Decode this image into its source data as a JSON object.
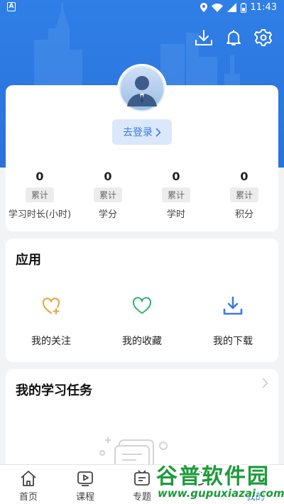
{
  "status_bar": {
    "time": "11:43",
    "left_badge": "A"
  },
  "header": {
    "icons": [
      "download-icon",
      "bell-icon",
      "gear-icon"
    ]
  },
  "profile": {
    "login_label": "去登录",
    "stats": [
      {
        "value": "0",
        "tag": "累计",
        "label": "学习时长(小时)"
      },
      {
        "value": "0",
        "tag": "累计",
        "label": "学分"
      },
      {
        "value": "0",
        "tag": "累计",
        "label": "学时"
      },
      {
        "value": "0",
        "tag": "累计",
        "label": "积分"
      }
    ]
  },
  "apps": {
    "title": "应用",
    "items": [
      {
        "label": "我的关注",
        "icon": "heart-plus-icon",
        "color": "#e8a23a"
      },
      {
        "label": "我的收藏",
        "icon": "heart-icon",
        "color": "#2bb56b"
      },
      {
        "label": "我的下载",
        "icon": "download-tray-icon",
        "color": "#3a7ce0"
      }
    ]
  },
  "tasks": {
    "title": "我的学习任务"
  },
  "tabbar": {
    "tabs": [
      {
        "label": "首页",
        "icon": "home-icon"
      },
      {
        "label": "课程",
        "icon": "play-icon"
      },
      {
        "label": "专题",
        "icon": "topic-icon"
      },
      {
        "label": "",
        "icon": "tab4-icon"
      },
      {
        "label": "我的",
        "icon": "user-icon"
      }
    ]
  },
  "watermark": {
    "title": "谷普软件园",
    "url": "www.gupuxiazai.com"
  },
  "colors": {
    "header_blue": "#2f7fe6",
    "accent": "#3a7ce0"
  }
}
